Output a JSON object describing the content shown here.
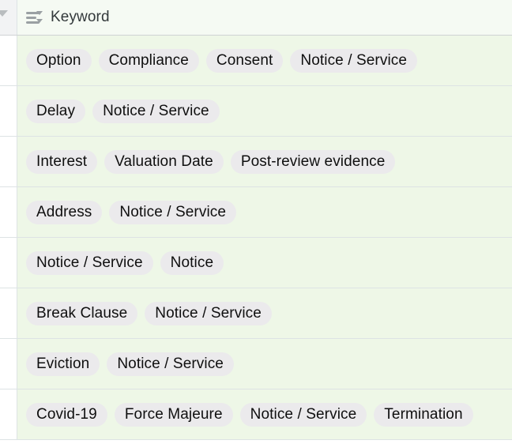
{
  "gutter": {
    "icon": "chevron-down-icon"
  },
  "column": {
    "icon": "multi-select-list-icon",
    "label": "Keyword"
  },
  "colors": {
    "row_background": "#eef7e7",
    "header_background": "#f5faf3",
    "gutter_header_background": "#f2f3f4",
    "gutter_cell_background": "#ffffff",
    "tag_background": "#ebeaec",
    "tag_text": "#0f0f0f",
    "row_border": "#dde3e4",
    "header_border": "#cfd2d4",
    "icon_gray": "#9aa0a3"
  },
  "rows": [
    {
      "tags": [
        "Option",
        "Compliance",
        "Consent",
        "Notice / Service"
      ]
    },
    {
      "tags": [
        "Delay",
        "Notice / Service"
      ]
    },
    {
      "tags": [
        "Interest",
        "Valuation Date",
        "Post-review evidence"
      ]
    },
    {
      "tags": [
        "Address",
        "Notice / Service"
      ]
    },
    {
      "tags": [
        "Notice / Service",
        "Notice"
      ]
    },
    {
      "tags": [
        "Break Clause",
        "Notice / Service"
      ]
    },
    {
      "tags": [
        "Eviction",
        "Notice / Service"
      ]
    },
    {
      "tags": [
        "Covid-19",
        "Force Majeure",
        "Notice / Service",
        "Termination"
      ]
    }
  ]
}
